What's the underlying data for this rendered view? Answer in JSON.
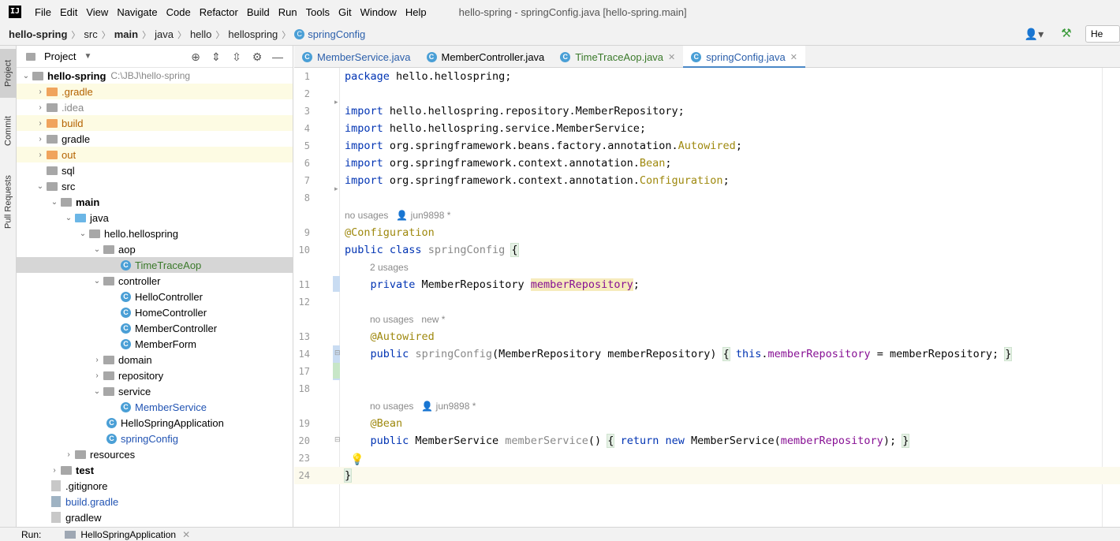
{
  "app": {
    "logo": "IJ",
    "window_title": "hello-spring - springConfig.java [hello-spring.main]",
    "menu": [
      "File",
      "Edit",
      "View",
      "Navigate",
      "Code",
      "Refactor",
      "Build",
      "Run",
      "Tools",
      "Git",
      "Window",
      "Help"
    ]
  },
  "breadcrumb": [
    "hello-spring",
    "src",
    "main",
    "java",
    "hello",
    "hellospring",
    "springConfig"
  ],
  "run_config": "He",
  "left_strip": [
    "Project",
    "Commit",
    "Pull Requests"
  ],
  "project_panel": {
    "title": "Project",
    "root": {
      "name": "hello-spring",
      "path": "C:\\JBJ\\hello-spring"
    },
    "items": [
      {
        "label": ".gradle"
      },
      {
        "label": ".idea"
      },
      {
        "label": "build"
      },
      {
        "label": "gradle"
      },
      {
        "label": "out"
      },
      {
        "label": "sql"
      },
      {
        "label": "src"
      },
      {
        "label": "main"
      },
      {
        "label": "java"
      },
      {
        "label": "hello.hellospring"
      },
      {
        "label": "aop"
      },
      {
        "label": "TimeTraceAop"
      },
      {
        "label": "controller"
      },
      {
        "label": "HelloController"
      },
      {
        "label": "HomeController"
      },
      {
        "label": "MemberController"
      },
      {
        "label": "MemberForm"
      },
      {
        "label": "domain"
      },
      {
        "label": "repository"
      },
      {
        "label": "service"
      },
      {
        "label": "MemberService"
      },
      {
        "label": "HelloSpringApplication"
      },
      {
        "label": "springConfig"
      },
      {
        "label": "resources"
      },
      {
        "label": "test"
      },
      {
        "label": ".gitignore"
      },
      {
        "label": "build.gradle"
      },
      {
        "label": "gradlew"
      }
    ]
  },
  "tabs": [
    {
      "label": "MemberService.java"
    },
    {
      "label": "MemberController.java"
    },
    {
      "label": "TimeTraceAop.java"
    },
    {
      "label": "springConfig.java"
    }
  ],
  "editor": {
    "lines": {
      "l1": "1",
      "l2": "2",
      "l3": "3",
      "l4": "4",
      "l5": "5",
      "l6": "6",
      "l7": "7",
      "l8": "8",
      "l9": "9",
      "l10": "10",
      "l11": "11",
      "l12": "12",
      "l13": "13",
      "l14": "14",
      "l17": "17",
      "l18": "18",
      "l19": "19",
      "l20": "20",
      "l23": "23",
      "l24": "24"
    },
    "hints": {
      "class_usage": "no usages",
      "class_author": "jun9898 *",
      "field_usage": "2 usages",
      "ctor_usage": "no usages",
      "ctor_author": "new *",
      "bean_usage": "no usages",
      "bean_author": "jun9898 *"
    }
  },
  "bottom": {
    "run_label": "Run:",
    "run_tab": "HelloSpringApplication"
  }
}
